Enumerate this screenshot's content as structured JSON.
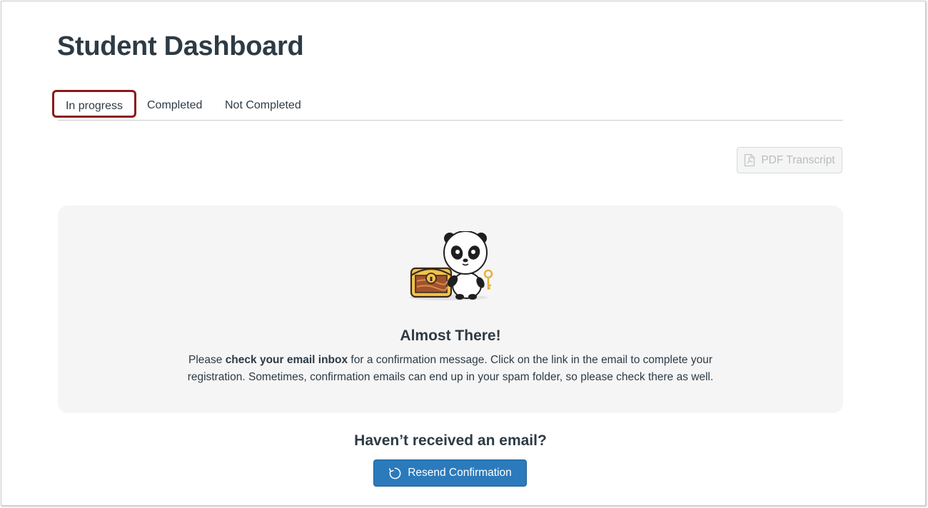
{
  "page": {
    "title": "Student Dashboard"
  },
  "tabs": [
    {
      "label": "In progress",
      "active": true
    },
    {
      "label": "Completed",
      "active": false
    },
    {
      "label": "Not Completed",
      "active": false
    }
  ],
  "toolbar": {
    "pdf_label": "PDF Transcript",
    "pdf_icon": "pdf-file-icon",
    "pdf_disabled": true
  },
  "card": {
    "title": "Almost There!",
    "text_prefix": "Please ",
    "text_bold": "check your email inbox",
    "text_suffix": " for a confirmation message. Click on the link in the email to complete your registration. Sometimes, confirmation emails can end up in your spam folder, so please check there as well.",
    "illustration": "panda-treasure-chest-illustration"
  },
  "resend": {
    "heading": "Haven’t received an email?",
    "button_label": "Resend Confirmation",
    "button_icon": "refresh-icon"
  },
  "colors": {
    "active_tab_outline": "#8b1a1a",
    "primary_button": "#2b7abc",
    "card_background": "#f5f5f5",
    "text": "#2d3b45"
  }
}
